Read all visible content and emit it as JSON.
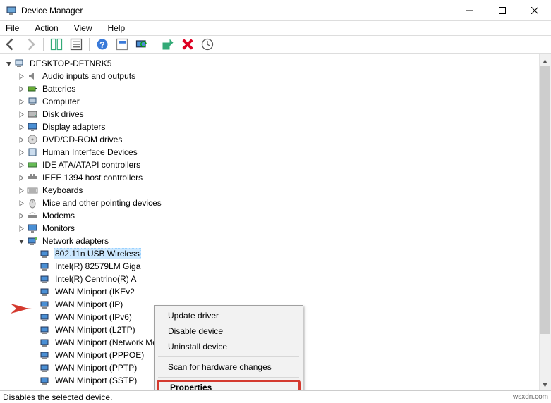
{
  "window": {
    "title": "Device Manager"
  },
  "menu": {
    "file": "File",
    "action": "Action",
    "view": "View",
    "help": "Help"
  },
  "tree": {
    "root": "DESKTOP-DFTNRK5",
    "audio": "Audio inputs and outputs",
    "batteries": "Batteries",
    "computer": "Computer",
    "disk": "Disk drives",
    "display": "Display adapters",
    "dvd": "DVD/CD-ROM drives",
    "hid": "Human Interface Devices",
    "ide": "IDE ATA/ATAPI controllers",
    "ieee": "IEEE 1394 host controllers",
    "keyboards": "Keyboards",
    "mice": "Mice and other pointing devices",
    "modems": "Modems",
    "monitors": "Monitors",
    "network": "Network adapters",
    "net_items": [
      "802.11n USB Wireless",
      "Intel(R) 82579LM Giga",
      "Intel(R) Centrino(R) A",
      "WAN Miniport (IKEv2",
      "WAN Miniport (IP)",
      "WAN Miniport (IPv6)",
      "WAN Miniport (L2TP)",
      "WAN Miniport (Network Monitor)",
      "WAN Miniport (PPPOE)",
      "WAN Miniport (PPTP)",
      "WAN Miniport (SSTP)"
    ]
  },
  "context_menu": {
    "update": "Update driver",
    "disable": "Disable device",
    "uninstall": "Uninstall device",
    "scan": "Scan for hardware changes",
    "properties": "Properties"
  },
  "status": {
    "text": "Disables the selected device.",
    "watermark": "wsxdn.com"
  }
}
